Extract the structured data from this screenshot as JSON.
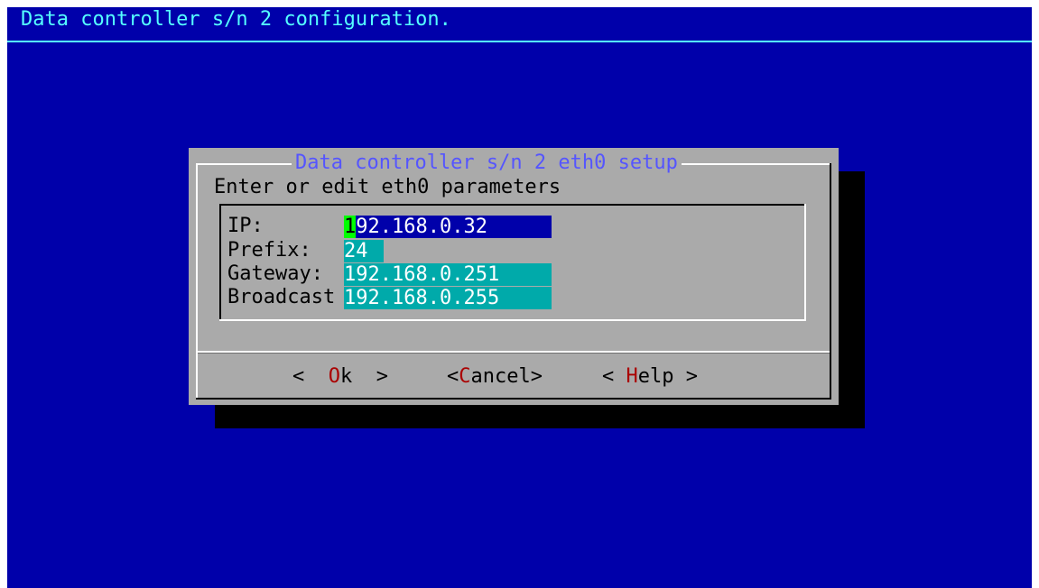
{
  "backtitle": "Data controller s/n 2 configuration.",
  "dialog": {
    "title": "Data controller s/n 2 eth0 setup",
    "prompt": "Enter or edit eth0 parameters"
  },
  "form": {
    "fields": [
      {
        "label": "IP:",
        "value_first": "1",
        "value_rest": "92.168.0.32",
        "active": true
      },
      {
        "label": "Prefix:",
        "value": "24"
      },
      {
        "label": "Gateway:",
        "value": "192.168.0.251"
      },
      {
        "label": "Broadcast",
        "value": "192.168.0.255"
      }
    ]
  },
  "buttons": {
    "ok": {
      "left": "<  ",
      "hot": "O",
      "rest": "k",
      "right": "  >"
    },
    "cancel": {
      "left": "<",
      "hot": "C",
      "rest": "ancel",
      "right": ">"
    },
    "help": {
      "left": "< ",
      "hot": "H",
      "rest": "elp",
      "right": " >"
    }
  },
  "colors": {
    "screen_bg": "#0000aa",
    "dialog_bg": "#aaaaaa",
    "title_fg": "#5555ff",
    "field_bg": "#00aaaa",
    "cursor_bg": "#00ff00",
    "hotkey_fg": "#aa0000"
  }
}
